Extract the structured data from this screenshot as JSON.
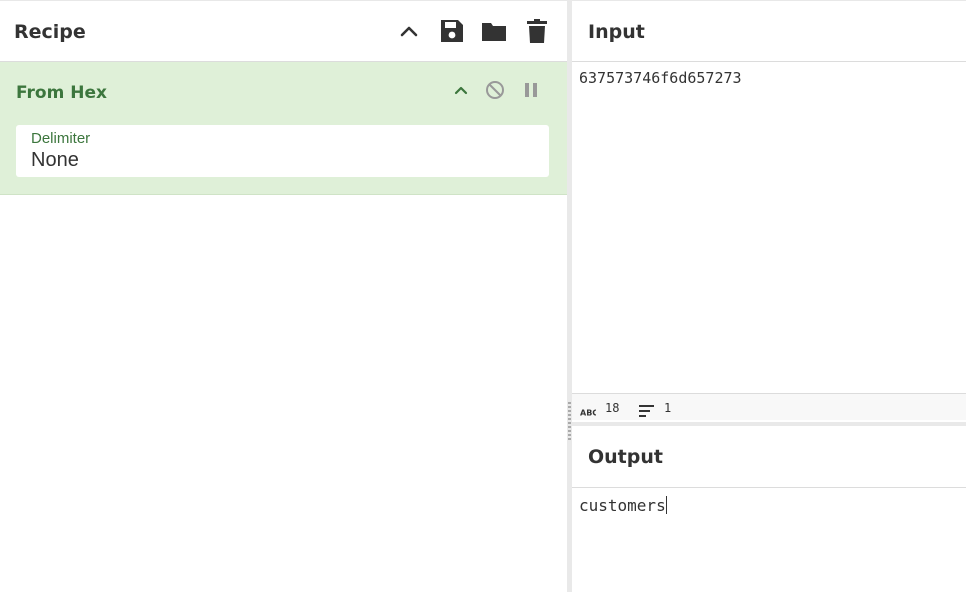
{
  "recipe": {
    "title": "Recipe",
    "toolbar_icons": [
      "chevron-up-icon",
      "save-icon",
      "folder-icon",
      "trash-icon"
    ]
  },
  "operation": {
    "name": "From Hex",
    "controls": [
      "chevron-up-icon",
      "disable-icon",
      "pause-icon"
    ],
    "arg_label": "Delimiter",
    "arg_value": "None"
  },
  "input": {
    "title": "Input",
    "text": "637573746f6d657273",
    "status": {
      "length_icon": "abc-icon",
      "length": "18",
      "lines_icon": "lines-icon",
      "lines": "1"
    }
  },
  "output": {
    "title": "Output",
    "text": "customers"
  },
  "colors": {
    "operation_bg": "#dff0d8",
    "operation_text": "#3c763d",
    "text": "#333333",
    "divider": "#e9e9e9"
  }
}
